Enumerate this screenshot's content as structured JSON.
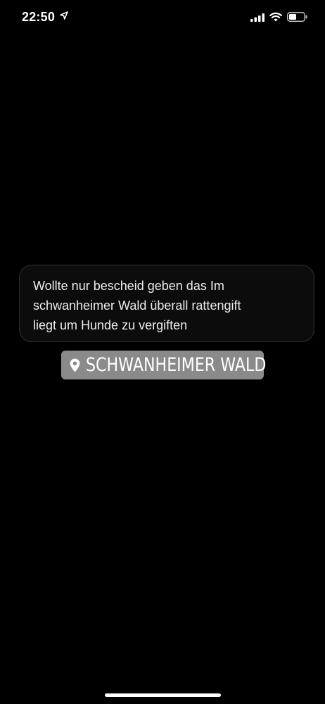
{
  "status_bar": {
    "time": "22:50",
    "icons": [
      "location-arrow-icon",
      "signal-icon",
      "wifi-icon",
      "battery-icon"
    ]
  },
  "story": {
    "text_lines": [
      "Wollte nur bescheid geben das Im",
      "schwanheimer Wald überall rattengift",
      "liegt um Hunde zu vergiften"
    ],
    "location_sticker": {
      "icon": "map-pin-icon",
      "label": "SCHWANHEIMER WALD"
    }
  },
  "colors": {
    "background": "#000000",
    "text": "#ededed",
    "sticker_bg": "#8a8a8a"
  }
}
